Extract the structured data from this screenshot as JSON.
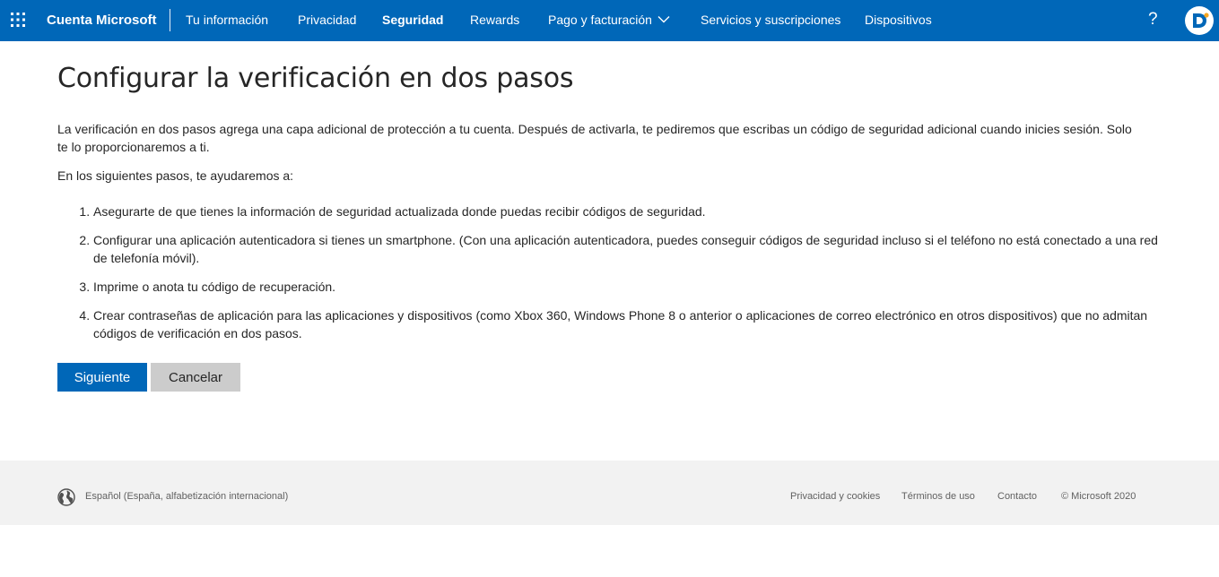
{
  "header": {
    "brand": "Cuenta Microsoft",
    "nav": [
      {
        "label": "Tu información"
      },
      {
        "label": "Privacidad"
      },
      {
        "label": "Seguridad",
        "active": true
      },
      {
        "label": "Rewards"
      },
      {
        "label": "Pago y facturación",
        "has_dropdown": true
      },
      {
        "label": "Servicios y suscripciones"
      },
      {
        "label": "Dispositivos"
      }
    ],
    "help_label": "?",
    "icons": {
      "apps": "waffle-grid-icon",
      "help": "question-mark-icon",
      "avatar": "profile-avatar-icon",
      "dropdown": "chevron-down-icon"
    },
    "colors": {
      "bar": "#0067b8",
      "text": "#ffffff"
    }
  },
  "main": {
    "title": "Configurar la verificación en dos pasos",
    "intro": "La verificación en dos pasos agrega una capa adicional de protección a tu cuenta. Después de activarla, te pediremos que escribas un código de seguridad adicional cuando inicies sesión. Solo te lo proporcionaremos a ti.",
    "lead": "En los siguientes pasos, te ayudaremos a:",
    "steps": [
      "Asegurarte de que tienes la información de seguridad actualizada donde puedas recibir códigos de seguridad.",
      "Configurar una aplicación autenticadora si tienes un smartphone. (Con una aplicación autenticadora, puedes conseguir códigos de seguridad incluso si el teléfono no está conectado a una red de telefonía móvil).",
      "Imprime o anota tu código de recuperación.",
      "Crear contraseñas de aplicación para las aplicaciones y dispositivos (como Xbox 360, Windows Phone 8 o anterior o aplicaciones de correo electrónico en otros dispositivos) que no admitan códigos de verificación en dos pasos."
    ],
    "buttons": {
      "next": "Siguiente",
      "cancel": "Cancelar"
    },
    "colors": {
      "primary": "#0067b8",
      "secondary": "#cccccc"
    }
  },
  "footer": {
    "locale": "Español (España, alfabetización internacional)",
    "links": {
      "privacy": "Privacidad y cookies",
      "terms": "Términos de uso",
      "contact": "Contacto"
    },
    "copyright": "© Microsoft 2020",
    "icons": {
      "locale": "globe-icon"
    },
    "colors": {
      "background": "#f2f2f2"
    }
  }
}
